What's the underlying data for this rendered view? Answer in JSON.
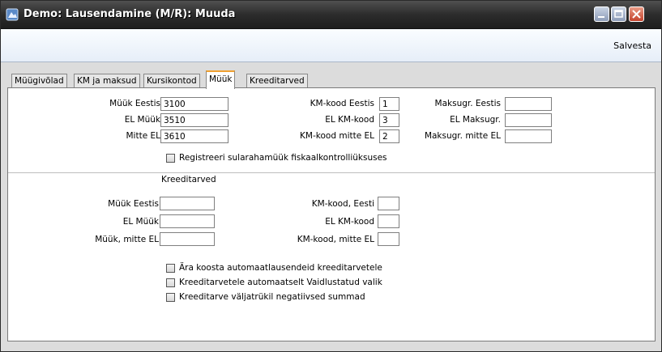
{
  "window": {
    "title": "Demo: Lausendamine (M/R): Muuda",
    "buttons": [
      "minimize",
      "maximize",
      "close"
    ]
  },
  "menubar": {
    "save_label": "Salvesta"
  },
  "tabs": [
    {
      "label": "Müügivõlad",
      "active": false
    },
    {
      "label": "KM ja maksud",
      "active": false
    },
    {
      "label": "Kursikontod",
      "active": false
    },
    {
      "label": "Müük",
      "active": true
    },
    {
      "label": "Kreeditarved",
      "active": false
    }
  ],
  "sales": {
    "muuk_eestis_label": "Müük Eestis",
    "muuk_eestis_value": "3100",
    "el_muuk_label": "EL Müük",
    "el_muuk_value": "3510",
    "mitte_el_label": "Mitte EL",
    "mitte_el_value": "3610",
    "km_kood_eestis_label": "KM-kood Eestis",
    "km_kood_eestis_value": "1",
    "el_km_kood_label": "EL KM-kood",
    "el_km_kood_value": "3",
    "km_kood_mitte_el_label": "KM-kood mitte EL",
    "km_kood_mitte_el_value": "2",
    "maksugr_eestis_label": "Maksugr. Eestis",
    "maksugr_eestis_value": "",
    "el_maksugr_label": "EL Maksugr.",
    "el_maksugr_value": "",
    "maksugr_mitte_el_label": "Maksugr. mitte EL",
    "maksugr_mitte_el_value": "",
    "fiscal_checkbox_label": "Registreeri sularahamüük fiskaalkontrolliüksuses"
  },
  "credit_notes": {
    "section_title": "Kreeditarved",
    "muuk_eestis_label": "Müük Eestis",
    "muuk_eestis_value": "",
    "el_muuk_label": "EL Müük",
    "el_muuk_value": "",
    "muuk_mitte_el_label": "Müük, mitte EL",
    "muuk_mitte_el_value": "",
    "km_kood_eesti_label": "KM-kood, Eesti",
    "km_kood_eesti_value": "",
    "el_km_kood_label": "EL KM-kood",
    "el_km_kood_value": "",
    "km_kood_mitte_el_label": "KM-kood, mitte EL",
    "km_kood_mitte_el_value": "",
    "checkbox_1_label": "Ära koosta automaatlausendeid kreeditarvetele",
    "checkbox_2_label": "Kreeditarvetele automaatselt Vaidlustatud valik",
    "checkbox_3_label": "Kreeditarve väljatrükil negatiivsed summad"
  }
}
